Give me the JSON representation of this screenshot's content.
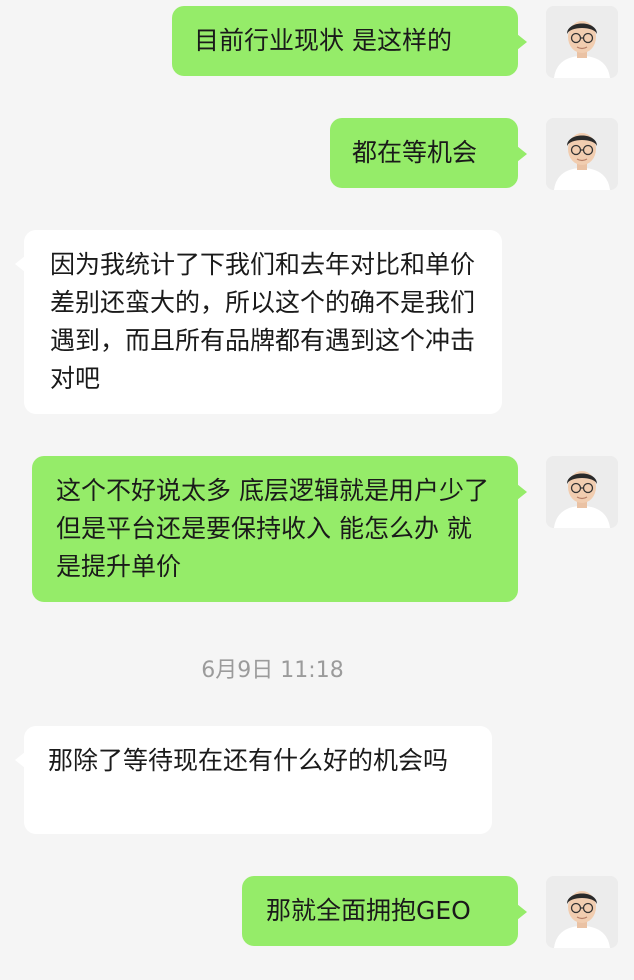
{
  "conversation": {
    "messages": [
      {
        "id": 1,
        "sender": "me",
        "text": "目前行业现状  是这样的"
      },
      {
        "id": 2,
        "sender": "me",
        "text": "都在等机会"
      },
      {
        "id": 3,
        "sender": "them",
        "text": "因为我统计了下我们和去年对比和单价 差别还蛮大的，所以这个的确不是我们遇到，而且所有品牌都有遇到这个冲击对吧"
      },
      {
        "id": 4,
        "sender": "me",
        "text": "这个不好说太多 底层逻辑就是用户少了 但是平台还是要保持收入 能怎么办 就是提升单价"
      },
      {
        "id": 5,
        "sender": "them",
        "text": "那除了等待现在还有什么好的机会吗"
      },
      {
        "id": 6,
        "sender": "me",
        "text": "那就全面拥抱GEO"
      }
    ],
    "timestamp": "6月9日 11:18"
  },
  "colors": {
    "background": "#f5f5f5",
    "my_bubble": "#95ec69",
    "their_bubble": "#ffffff"
  },
  "icons": {
    "avatar": "person-photo-avatar"
  }
}
